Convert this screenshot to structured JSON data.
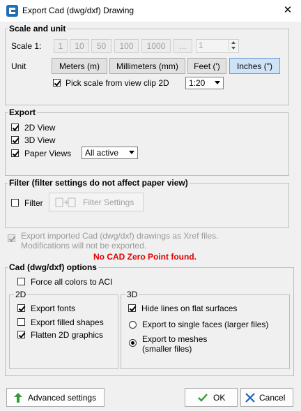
{
  "window": {
    "title": "Export Cad (dwg/dxf) Drawing"
  },
  "scale_unit": {
    "legend": "Scale and unit",
    "scale_label": "Scale 1:",
    "scale_buttons": [
      "1",
      "10",
      "50",
      "100",
      "1000",
      "..."
    ],
    "scale_value": "1",
    "unit_label": "Unit",
    "unit_buttons": [
      "Meters (m)",
      "Millimeters (mm)",
      "Feet (')",
      "Inches (\")"
    ],
    "selected_unit": "Inches (\")",
    "pick_scale_label": "Pick scale from view clip 2D",
    "pick_scale_checked": true,
    "pick_scale_value": "1:20"
  },
  "export": {
    "legend": "Export",
    "view_2d": "2D View",
    "view_3d": "3D View",
    "paper_views": "Paper Views",
    "paper_views_select": "All active"
  },
  "filter": {
    "legend": "Filter (filter settings do not affect paper view)",
    "filter_label": "Filter",
    "filter_settings_label": "Filter Settings"
  },
  "xref": {
    "line1": "Export imported Cad (dwg/dxf) drawings as Xref files.",
    "line2": "Modifications will not be exported.",
    "warning": "No CAD Zero Point found."
  },
  "cad_options": {
    "legend": "Cad (dwg/dxf) options",
    "force_colors": "Force all colors to ACI",
    "group_2d": {
      "legend": "2D",
      "export_fonts": "Export fonts",
      "export_filled": "Export filled shapes",
      "flatten": "Flatten 2D graphics"
    },
    "group_3d": {
      "legend": "3D",
      "hide_lines": "Hide lines on flat surfaces",
      "single_faces": "Export to single faces (larger files)",
      "meshes_line1": "Export to meshes",
      "meshes_line2": "(smaller files)"
    }
  },
  "footer": {
    "advanced": "Advanced settings",
    "ok": "OK",
    "cancel": "Cancel"
  },
  "icons": {
    "app": "app-icon",
    "close": "close-icon",
    "advanced": "green-up-arrow-icon",
    "ok": "green-check-icon",
    "cancel": "blue-x-icon",
    "filter": "filter-icon"
  },
  "colors": {
    "warning": "#e00000",
    "ok_icon": "#2e9e2e",
    "cancel_icon": "#1f5fbf",
    "selected_unit_bg": "#cfe3f7"
  }
}
